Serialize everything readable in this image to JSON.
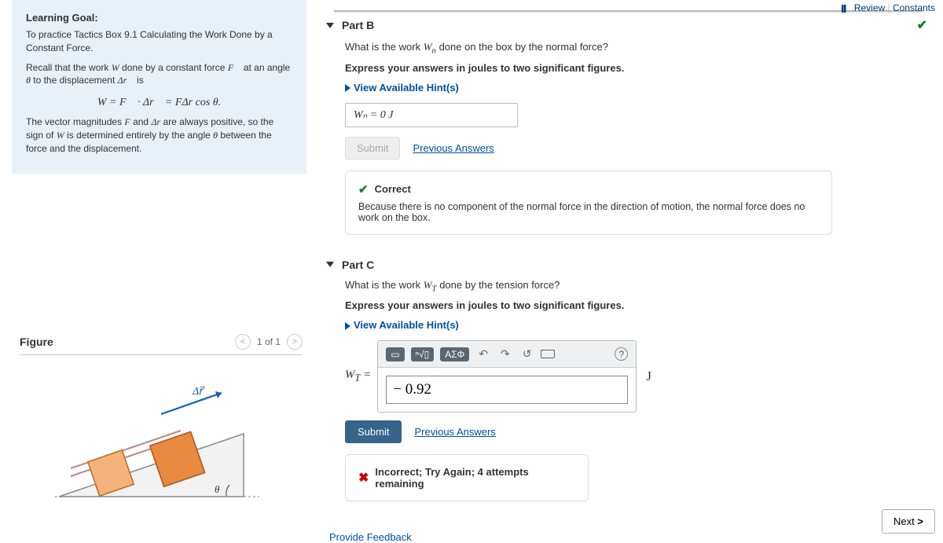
{
  "top": {
    "review": "Review",
    "constants": "Constants"
  },
  "learning_goal": {
    "heading": "Learning Goal:",
    "intro": "To practice Tactics Box 9.1 Calculating the Work Done by a Constant Force.",
    "recall_prefix": "Recall that the work ",
    "recall_mid1": " done by a constant force ",
    "recall_mid2": " at an angle ",
    "recall_mid3": " to the displacement ",
    "recall_end": " is",
    "formula": "W = F⃗ · Δr⃗ = FΔr cos θ.",
    "para2_a": "The vector magnitudes ",
    "para2_b": " and ",
    "para2_c": " are always positive, so the sign of ",
    "para2_d": " is determined entirely by the angle ",
    "para2_e": " between the force and the displacement."
  },
  "figure": {
    "title": "Figure",
    "page": "1 of 1",
    "arrow_label": "Δr⃗",
    "angle_label": "θ"
  },
  "partB": {
    "title": "Part B",
    "question_a": "What is the work ",
    "question_b": " done on the box by the normal force?",
    "express": "Express your answers in joules to two significant figures.",
    "hints": "View Available Hint(s)",
    "answer": "Wₙ = 0  J",
    "submit": "Submit",
    "prev": "Previous Answers",
    "correct": "Correct",
    "explain": "Because there is no component of the normal force in the direction of motion, the normal force does no work on the box."
  },
  "partC": {
    "title": "Part C",
    "question_a": "What is the work ",
    "question_b": " done by the tension force?",
    "express": "Express your answers in joules to two significant figures.",
    "hints": "View Available Hint(s)",
    "toolbar": {
      "greek": "ΑΣΦ"
    },
    "label": "W_T =",
    "value": "− 0.92",
    "unit": "J",
    "submit": "Submit",
    "prev": "Previous Answers",
    "incorrect": "Incorrect; Try Again; 4 attempts remaining"
  },
  "footer": {
    "feedback": "Provide Feedback",
    "next": "Next"
  }
}
